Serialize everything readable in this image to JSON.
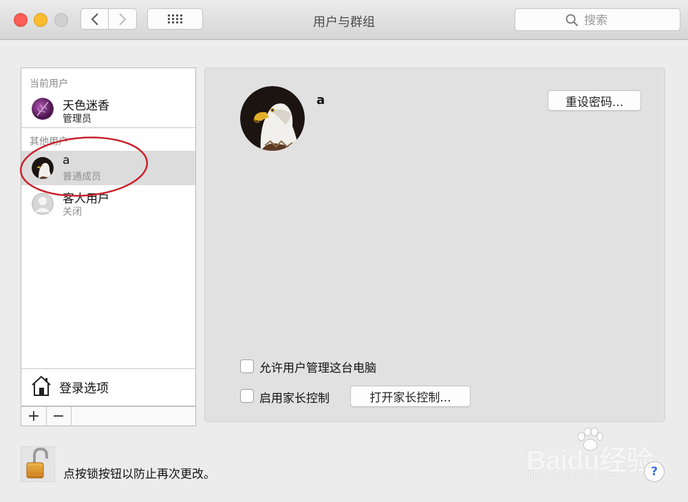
{
  "window": {
    "title": "用户与群组",
    "search_placeholder": "搜索"
  },
  "sidebar": {
    "current_users_label": "当前用户",
    "other_users_label": "其他用户",
    "users": [
      {
        "name": "天色迷香",
        "role": "管理员",
        "avatar": "purple-leaf-avatar"
      },
      {
        "name": "a",
        "role": "普通成员",
        "avatar": "eagle-avatar",
        "selected": true
      },
      {
        "name": "客人用户",
        "role": "关闭",
        "avatar": "generic-user-avatar"
      }
    ],
    "login_options_label": "登录选项",
    "add_button": "+",
    "remove_button": "−"
  },
  "detail": {
    "user_name": "a",
    "reset_password_button": "重设密码...",
    "allow_admin_label": "允许用户管理这台电脑",
    "allow_admin_checked": false,
    "parental_controls_label": "启用家长控制",
    "parental_controls_checked": false,
    "open_parental_button": "打开家长控制..."
  },
  "footer": {
    "lock_text": "点按锁按钮以防止再次更改。",
    "help_button": "?"
  },
  "watermark": {
    "brand": "Baidu经验",
    "url": "jingyan.baidu.com"
  },
  "colors": {
    "close": "#fd5d57",
    "minimize": "#fdbb2e",
    "zoom": "#d0d0d0",
    "selection": "#dcdcdc",
    "annotation": "#c8202a",
    "help_accent": "#3d6fd8"
  }
}
